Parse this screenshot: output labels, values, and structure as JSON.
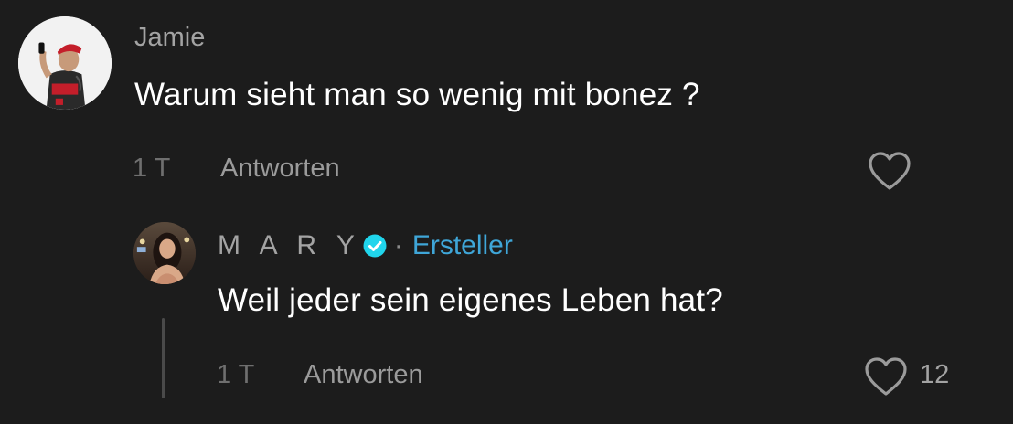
{
  "comment": {
    "username": "Jamie",
    "text": "Warum sieht man so wenig mit bonez ?",
    "time": "1 T",
    "reply_label": "Antworten",
    "like_icon": "heart-outline-icon"
  },
  "reply": {
    "username": "M A R Y",
    "verified_icon": "verified-badge-icon",
    "separator": "·",
    "creator_label": "Ersteller",
    "text": "Weil jeder sein eigenes Leben hat?",
    "time": "1 T",
    "reply_label": "Antworten",
    "like_icon": "heart-outline-icon",
    "like_count": "12"
  },
  "colors": {
    "background": "#1c1c1c",
    "creator_accent": "#3fa6d8",
    "verified_badge": "#20d5ec"
  }
}
